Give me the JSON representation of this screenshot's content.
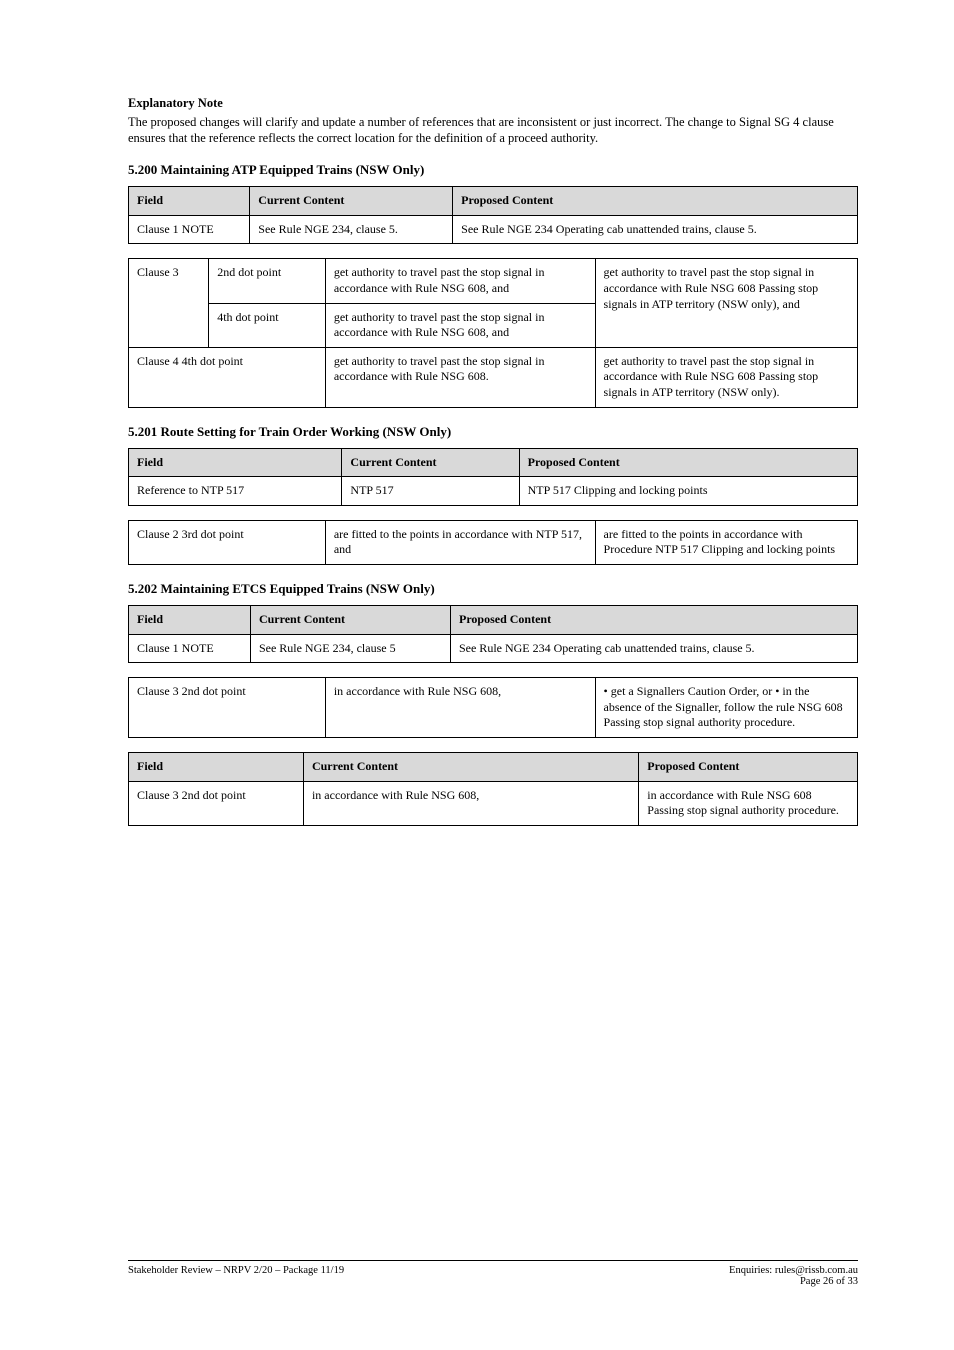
{
  "intro": {
    "heading": "Explanatory Note",
    "para": "The proposed changes will clarify and update a number of references that are inconsistent or just incorrect.  The change to Signal SG 4 clause ensures that the reference reflects the correct location for the definition of a proceed authority."
  },
  "s1": {
    "title": "5.200  Maintaining ATP Equipped Trains  (NSW Only)",
    "t1": {
      "headers": [
        "Field",
        "Current Content",
        "Proposed Content"
      ],
      "rows": [
        {
          "field": "Clause 1 NOTE",
          "current": "See Rule NGE 234, clause 5.",
          "proposed": "See Rule NGE 234 Operating  cab  unattended  trains, clause 5."
        }
      ]
    },
    "t2": {
      "rows": [
        {
          "field_rowspan": "Clause 3",
          "subfield": "2nd dot point",
          "current": "get authority to travel past the stop signal in accordance with Rule NSG 608, and",
          "proposed_merged": "get authority to travel past the stop signal in accordance with Rule NSG 608 Passing stop signals in ATP territory (NSW  only), and"
        },
        {
          "subfield": "4th dot point",
          "current": "get authority to travel past the stop signal in accordance with Rule NSG 608, and"
        },
        {
          "field": "Clause 4 4th dot point",
          "current": "get authority to travel past the stop signal in accordance with Rule NSG 608.",
          "proposed": "get authority to travel past the stop signal in accordance with Rule NSG 608 Passing stop signals in ATP territory (NSW  only)."
        }
      ]
    }
  },
  "s2": {
    "title": "5.201  Route Setting for Train Order Working  (NSW Only)",
    "t1": {
      "headers": [
        "Field",
        "Current Content",
        "Proposed Content"
      ],
      "rows": [
        {
          "field": "Reference to NTP 517",
          "current": "NTP 517",
          "proposed": "NTP 517 Clipping and locking  points"
        }
      ]
    },
    "t2": {
      "rows": [
        {
          "field": "Clause 2 3rd dot point",
          "current": "are fitted to the points in accordance with NTP 517, and",
          "proposed": "are fitted to the points in accordance with Procedure NTP 517 Clipping  and  locking points"
        }
      ]
    }
  },
  "s3": {
    "title": "5.202  Maintaining ETCS Equipped Trains  (NSW Only)",
    "t1": {
      "headers": [
        "Field",
        "Current Content",
        "Proposed Content"
      ],
      "rows": [
        {
          "field": "Clause 1 NOTE",
          "current": "See Rule NGE 234, clause 5",
          "proposed": "See Rule NGE 234 Operating  cab  unattended  trains, clause 5."
        }
      ]
    },
    "t2": {
      "rows": [
        {
          "field": "Clause 3 2nd dot point",
          "current": "in accordance with Rule NSG 608,",
          "proposed": "• get a Signallers Caution Order, or  •  in  the  absence  of  the Signaller,  follow  the  rule NSG 608 Passing  stop signal authority procedure."
        }
      ]
    },
    "t3": {
      "headers": [
        "Field",
        "Current Content",
        "Proposed Content"
      ],
      "rows": [
        {
          "field": "Clause 3 2nd dot point",
          "current": "in accordance with Rule NSG 608,",
          "proposed": "in accordance with Rule NSG 608 Passing  stop signal  authority procedure."
        }
      ]
    }
  },
  "footer": {
    "left": "Stakeholder Review – NRPV 2/20 – Package 11/19",
    "right_line1": "Enquiries: rules@rissb.com.au",
    "right_line2": "Page 26 of 33"
  }
}
